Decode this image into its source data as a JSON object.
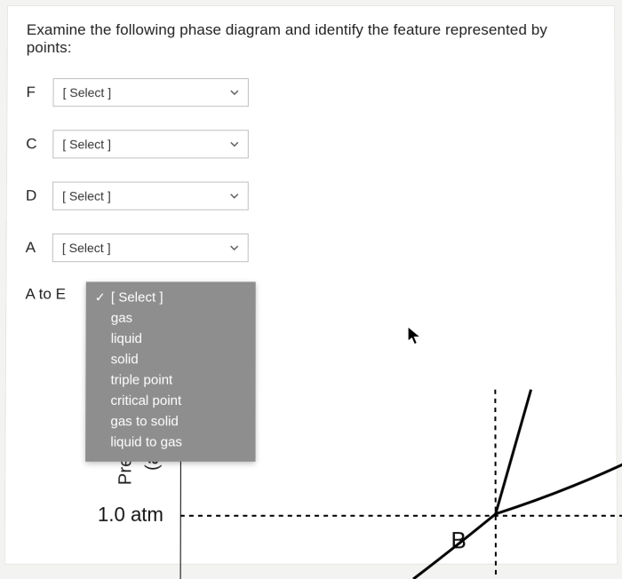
{
  "prompt": "Examine the following phase diagram and identify the feature represented by points:",
  "rows": {
    "F": {
      "label": "F",
      "select": "[ Select ]"
    },
    "C": {
      "label": "C",
      "select": "[ Select ]"
    },
    "D": {
      "label": "D",
      "select": "[ Select ]"
    },
    "A": {
      "label": "A",
      "select": "[ Select ]"
    },
    "AE": {
      "label": "A to E"
    }
  },
  "dropdown": {
    "options": [
      {
        "text": "[ Select ]",
        "checked": true
      },
      {
        "text": "gas",
        "checked": false
      },
      {
        "text": "liquid",
        "checked": false
      },
      {
        "text": "solid",
        "checked": false
      },
      {
        "text": "triple point",
        "checked": false
      },
      {
        "text": "critical point",
        "checked": false
      },
      {
        "text": "gas to solid",
        "checked": false
      },
      {
        "text": "liquid to gas",
        "checked": false
      }
    ]
  },
  "diagram": {
    "y_axis_main": "Pres",
    "y_axis_sub": "(at",
    "pressure_tick": "1.0 atm",
    "label_B": "B"
  }
}
